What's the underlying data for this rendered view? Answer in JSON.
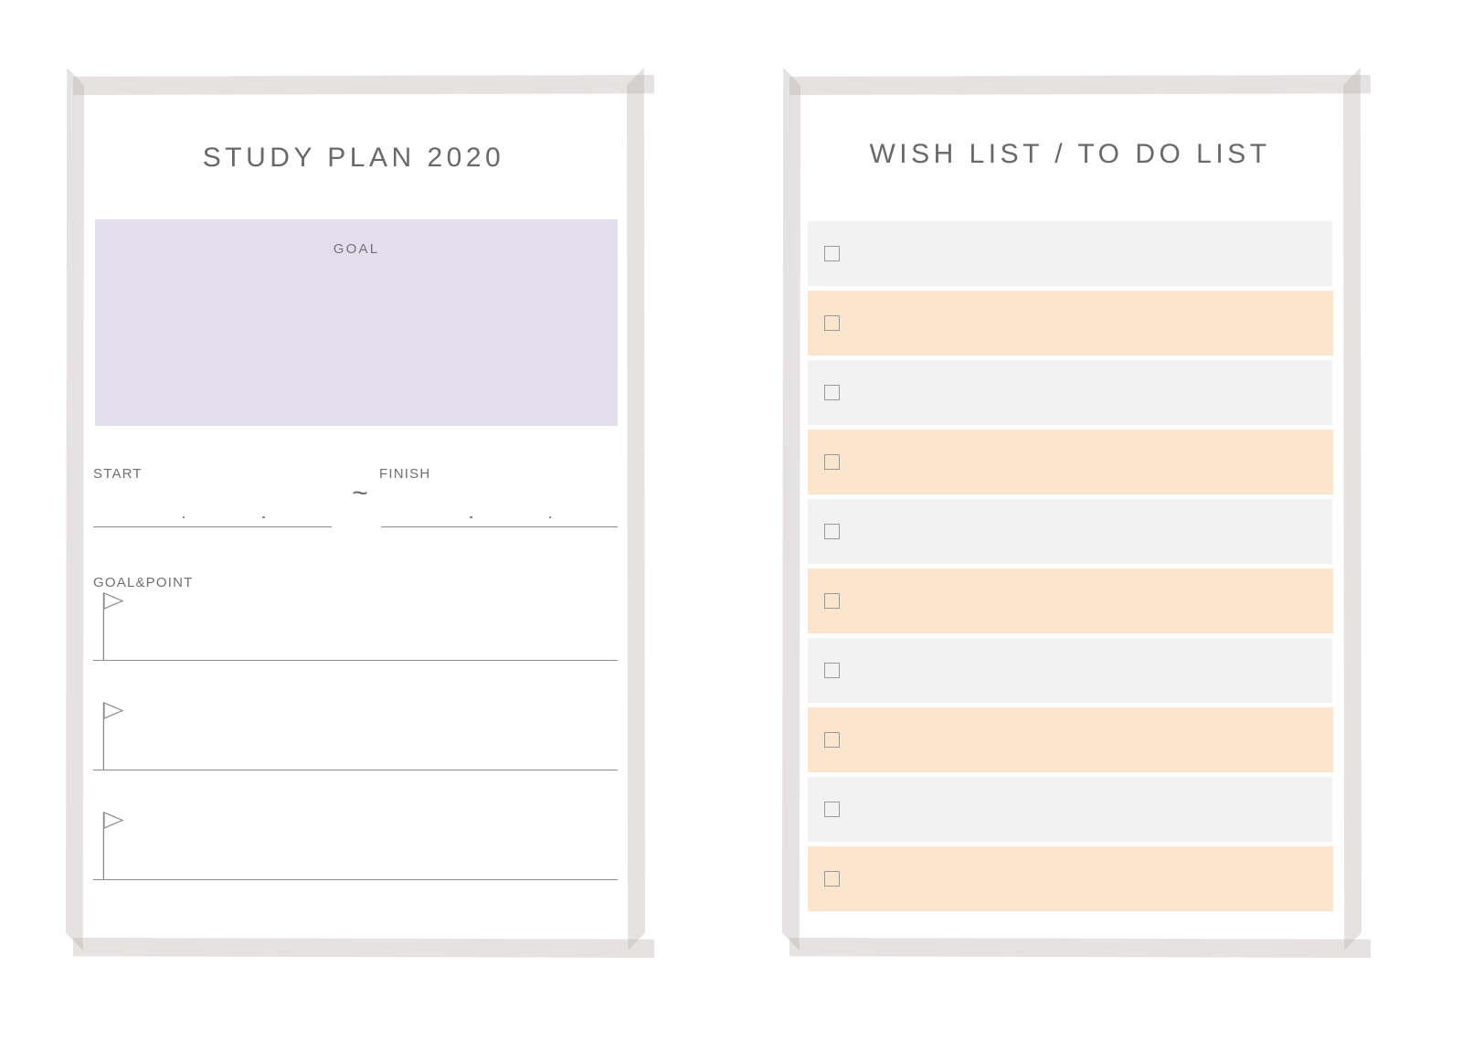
{
  "theme": {
    "tape_color": "#bab4af",
    "goal_box_color": "#e2deec",
    "row_gray": "#f2f2f2",
    "row_peach": "#fbe5cd",
    "ink": "#696969",
    "rule_color": "#8a8a8a"
  },
  "left_page": {
    "title": "STUDY PLAN 2020",
    "goal": {
      "label": "GOAL",
      "value": ""
    },
    "start": {
      "label": "START",
      "value": "",
      "separator_dots": [
        ".",
        "."
      ]
    },
    "finish": {
      "label": "FINISH",
      "value": "",
      "separator_dots": [
        ".",
        "."
      ]
    },
    "range_separator": "~",
    "goal_point": {
      "label": "GOAL&POINT",
      "rows": [
        {
          "icon": "flag-icon",
          "value": ""
        },
        {
          "icon": "flag-icon",
          "value": ""
        },
        {
          "icon": "flag-icon",
          "value": ""
        }
      ]
    }
  },
  "right_page": {
    "title": "WISH LIST / TO DO LIST",
    "checklist": [
      {
        "tone": "gray",
        "checked": false,
        "value": ""
      },
      {
        "tone": "peach",
        "checked": false,
        "value": ""
      },
      {
        "tone": "gray",
        "checked": false,
        "value": ""
      },
      {
        "tone": "peach",
        "checked": false,
        "value": ""
      },
      {
        "tone": "gray",
        "checked": false,
        "value": ""
      },
      {
        "tone": "peach",
        "checked": false,
        "value": ""
      },
      {
        "tone": "gray",
        "checked": false,
        "value": ""
      },
      {
        "tone": "peach",
        "checked": false,
        "value": ""
      },
      {
        "tone": "gray",
        "checked": false,
        "value": ""
      },
      {
        "tone": "peach",
        "checked": false,
        "value": ""
      }
    ]
  }
}
